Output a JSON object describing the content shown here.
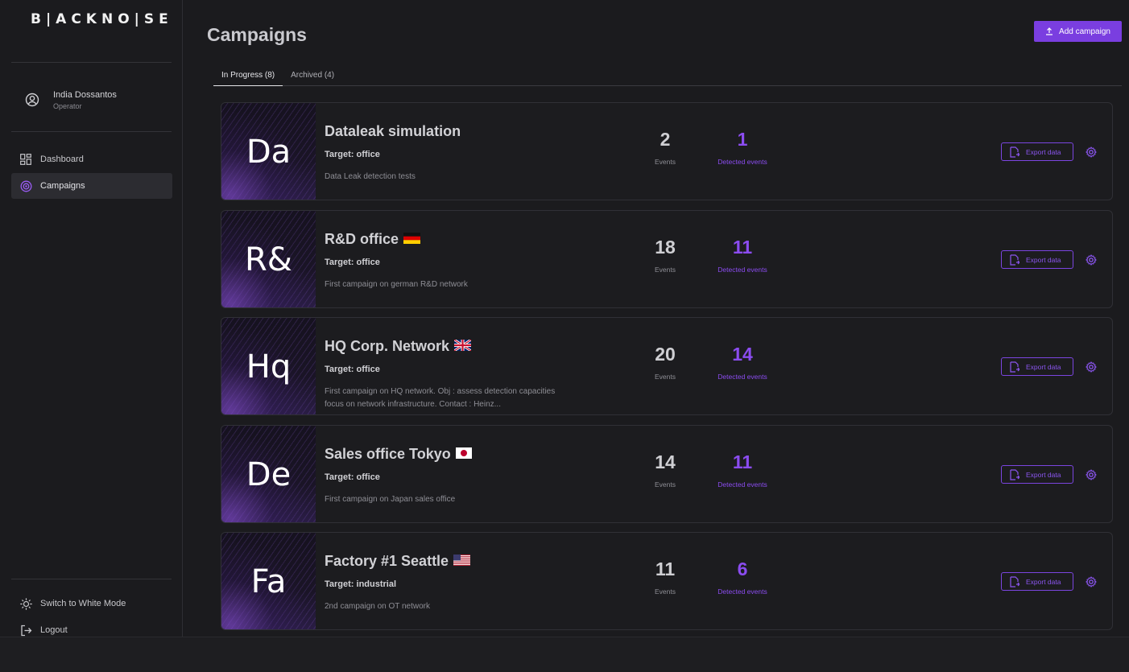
{
  "app": {
    "logo": "B|ACKNO|SE"
  },
  "user": {
    "name": "India Dossantos",
    "role": "Operator"
  },
  "nav": {
    "items": [
      {
        "label": "Dashboard",
        "icon": "dashboard-icon"
      },
      {
        "label": "Campaigns",
        "icon": "campaigns-icon",
        "active": true
      }
    ],
    "bottom": [
      {
        "label": "Switch to White Mode",
        "icon": "sun-icon"
      },
      {
        "label": "Logout",
        "icon": "logout-icon"
      }
    ]
  },
  "page": {
    "title": "Campaigns",
    "add_label": "Add campaign"
  },
  "tabs": [
    {
      "label": "In Progress (8)",
      "active": true
    },
    {
      "label": "Archived (4)"
    }
  ],
  "export_label": "Export data",
  "events_label": "Events",
  "detected_label": "Detected events",
  "campaigns": [
    {
      "initials": "Da",
      "title": "Dataleak simulation",
      "flag": "",
      "target": "Target: office",
      "desc": "Data Leak detection tests",
      "events": "2",
      "detected": "1"
    },
    {
      "initials": "R&",
      "title": "R&D office",
      "flag": "de",
      "target": "Target: office",
      "desc": "First campaign on german R&D network",
      "events": "18",
      "detected": "11"
    },
    {
      "initials": "Hq",
      "title": "HQ Corp. Network",
      "flag": "gb",
      "target": "Target: office",
      "desc": "First campaign on HQ network. Obj : assess detection capacities focus on network infrastructure. Contact : Heinz...",
      "events": "20",
      "detected": "14"
    },
    {
      "initials": "De",
      "title": "Sales office Tokyo",
      "flag": "jp",
      "target": "Target: office",
      "desc": "First campaign on Japan sales office",
      "events": "14",
      "detected": "11"
    },
    {
      "initials": "Fa",
      "title": "Factory #1 Seattle",
      "flag": "us",
      "target": "Target: industrial",
      "desc": "2nd campaign on OT network",
      "events": "11",
      "detected": "6"
    }
  ],
  "colors": {
    "accent": "#7a3ee0",
    "background": "#1b1b1e"
  }
}
